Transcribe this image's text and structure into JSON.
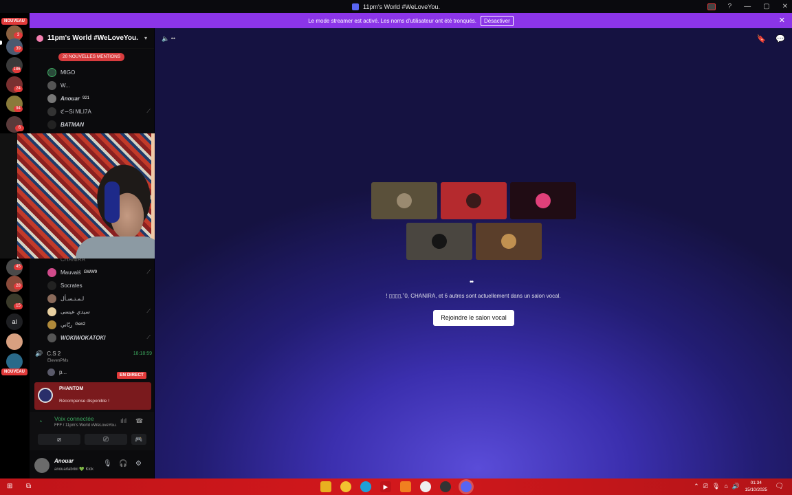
{
  "window": {
    "title": "11pm's World #WeLoveYou."
  },
  "banner": {
    "text": "Le mode streamer est activé. Les noms d'utilisateur ont été tronqués.",
    "button": "Désactiver",
    "close": "✕"
  },
  "rail": {
    "new_label": "NOUVEAU",
    "badges": [
      "3",
      "39",
      "186",
      "24",
      "94",
      "6",
      "45",
      "28",
      "15"
    ],
    "initials": "al",
    "new_label_bottom": "NOUVEAU"
  },
  "sidebar": {
    "server_name": "11pm's World #WeLoveYou.",
    "mentions": "20 NOUVELLES MENTIONS",
    "members": [
      {
        "name": "MIGO",
        "tag": ""
      },
      {
        "name": "W...",
        "tag": ""
      },
      {
        "name": "Anouar",
        "tag": "921"
      },
      {
        "name": "ℭ∽Si MLI7A",
        "tag": ""
      },
      {
        "name": "BATMAN",
        "tag": ""
      },
      {
        "name": "CHANIRA",
        "tag": ""
      },
      {
        "name": "Mauvaiś",
        "tag": "GWW9"
      },
      {
        "name": "Socrates",
        "tag": ""
      },
      {
        "name": "لـمـتـسـأل",
        "tag": ""
      },
      {
        "name": "سيدي عيسى",
        "tag": ""
      },
      {
        "name": "ربّاني",
        "tag": "Gen2"
      },
      {
        "name": "WOKIWOKATOKI",
        "tag": ""
      }
    ],
    "voice_channel": {
      "name": "C.S 2",
      "timer": "18:18:59",
      "sub": "ElevenPMs",
      "member": "p...",
      "live": "EN DIRECT"
    },
    "reward": {
      "title": "PHANTOM",
      "subtitle": "Récompense disponible !"
    },
    "voice_panel": {
      "title": "Voix connectée",
      "subtitle": "FFF / 11pm's World #WeLoveYou."
    },
    "user": {
      "name": "Anouar",
      "status": "anouarlabrini 💚 Kick"
    }
  },
  "stage": {
    "dots": "••",
    "message": "! ▯▯▯▯,˚0, CHANIRA, et 6 autres sont actuellement dans un salon vocal.",
    "join_button": "Rejoindre le salon vocal"
  },
  "taskbar": {
    "time": "01:34",
    "date": "15/10/2025"
  },
  "colors": {
    "accent": "#8b35e8",
    "voice_green": "#3ba55d",
    "live_red": "#e23a3a",
    "taskbar_red": "#c01419"
  }
}
